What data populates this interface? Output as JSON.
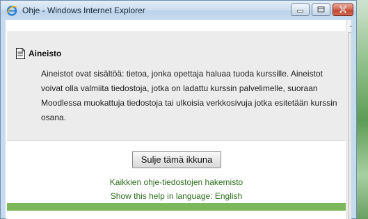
{
  "window": {
    "title": "Ohje - Windows Internet Explorer"
  },
  "help": {
    "heading": "Aineisto",
    "body": "Aineistot ovat sisältöä: tietoa, jonka opettaja haluaa tuoda kurssille. Aineistot voivat olla valmiita tiedostoja, jotka on ladattu kurssin palvelimelle, suoraan Moodlessa muokattuja tiedostoja tai ulkoisia verkkosivuja jotka esitetään kurssin osana."
  },
  "actions": {
    "close_label": "Sulje tämä ikkuna",
    "index_link": "Kaikkien ohje-tiedostojen hakemisto",
    "language_link": "Show this help in language: English"
  },
  "colors": {
    "link": "#2c6e1d",
    "footer_bar": "#7cb85a",
    "panel_bg": "#ececec"
  },
  "icons": {
    "title": "internet-explorer-icon",
    "heading": "document-icon"
  }
}
